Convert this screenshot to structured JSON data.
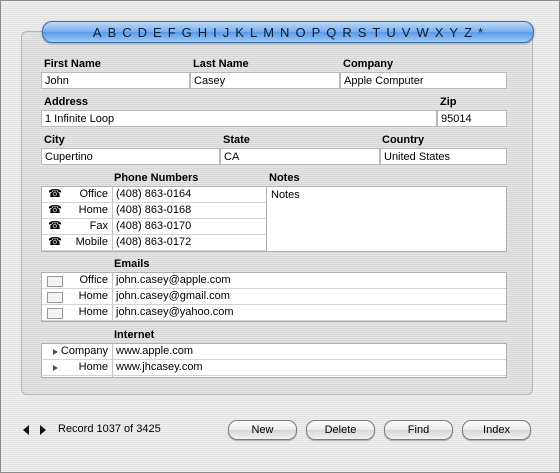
{
  "alphabet": [
    "A",
    "B",
    "C",
    "D",
    "E",
    "F",
    "G",
    "H",
    "I",
    "J",
    "K",
    "L",
    "M",
    "N",
    "O",
    "P",
    "Q",
    "R",
    "S",
    "T",
    "U",
    "V",
    "W",
    "X",
    "Y",
    "Z",
    "*"
  ],
  "labels": {
    "first_name": "First Name",
    "last_name": "Last Name",
    "company": "Company",
    "address": "Address",
    "zip": "Zip",
    "city": "City",
    "state": "State",
    "country": "Country",
    "phone_numbers": "Phone Numbers",
    "notes": "Notes",
    "emails": "Emails",
    "internet": "Internet"
  },
  "record": {
    "first_name": "John",
    "last_name": "Casey",
    "company": "Apple Computer",
    "address": "1 Infinite Loop",
    "zip": "95014",
    "city": "Cupertino",
    "state": "CA",
    "country": "United States",
    "notes": "Notes"
  },
  "phones": [
    {
      "type": "Office",
      "value": "(408) 863-0164",
      "icon": "telephone-icon"
    },
    {
      "type": "Home",
      "value": "(408) 863-0168",
      "icon": "telephone-icon"
    },
    {
      "type": "Fax",
      "value": "(408) 863-0170",
      "icon": "telephone-icon"
    },
    {
      "type": "Mobile",
      "value": "(408) 863-0172",
      "icon": "telephone-icon"
    }
  ],
  "emails": [
    {
      "type": "Office",
      "value": "john.casey@apple.com",
      "icon": "envelope-icon"
    },
    {
      "type": "Home",
      "value": "john.casey@gmail.com",
      "icon": "envelope-icon"
    },
    {
      "type": "Home",
      "value": "john.casey@yahoo.com",
      "icon": "envelope-icon"
    }
  ],
  "internet": [
    {
      "type": "Company",
      "value": "www.apple.com",
      "icon": "disclosure-arrow-icon"
    },
    {
      "type": "Home",
      "value": "www.jhcasey.com",
      "icon": "disclosure-arrow-icon"
    }
  ],
  "footer": {
    "record_status": "Record 1037 of 3425",
    "new_label": "New",
    "delete_label": "Delete",
    "find_label": "Find",
    "index_label": "Index"
  }
}
